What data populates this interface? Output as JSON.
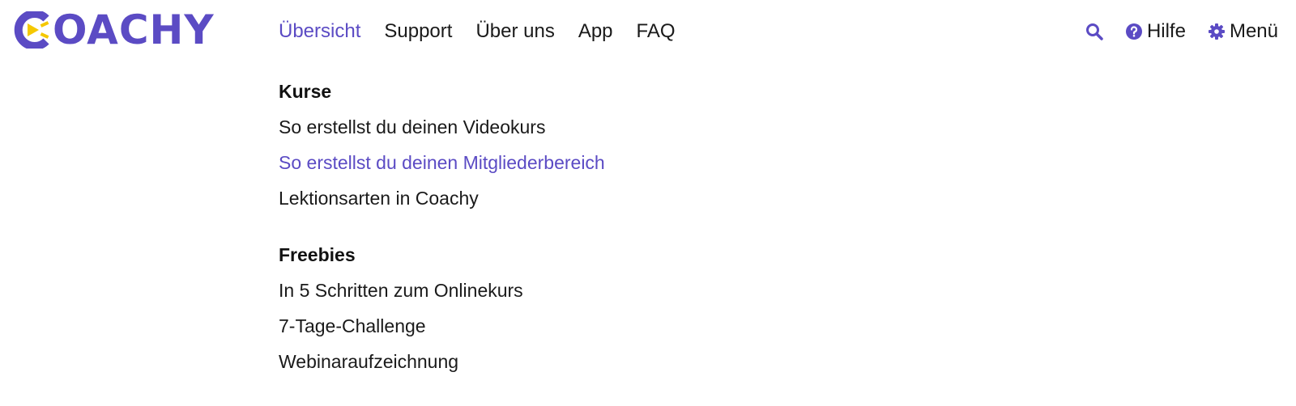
{
  "brand": {
    "name": "COACHY",
    "logo_text": "OACHY",
    "primary_color": "#5b4bc4",
    "accent_color": "#f5c800"
  },
  "nav": {
    "items": [
      {
        "label": "Übersicht",
        "active": true
      },
      {
        "label": "Support"
      },
      {
        "label": "Über uns"
      },
      {
        "label": "App"
      },
      {
        "label": "FAQ"
      }
    ]
  },
  "right_nav": {
    "search_icon": "search-icon",
    "help": {
      "icon": "question-circle-icon",
      "label": "Hilfe"
    },
    "menu": {
      "icon": "gear-icon",
      "label": "Menü"
    }
  },
  "sections": [
    {
      "title": "Kurse",
      "links": [
        {
          "label": "So erstellst du deinen Videokurs"
        },
        {
          "label": "So erstellst du deinen Mitgliederbereich",
          "highlighted": true
        },
        {
          "label": "Lektionsarten in Coachy"
        }
      ]
    },
    {
      "title": "Freebies",
      "links": [
        {
          "label": "In 5 Schritten zum Onlinekurs"
        },
        {
          "label": "7-Tage-Challenge"
        },
        {
          "label": "Webinaraufzeichnung"
        }
      ]
    }
  ]
}
